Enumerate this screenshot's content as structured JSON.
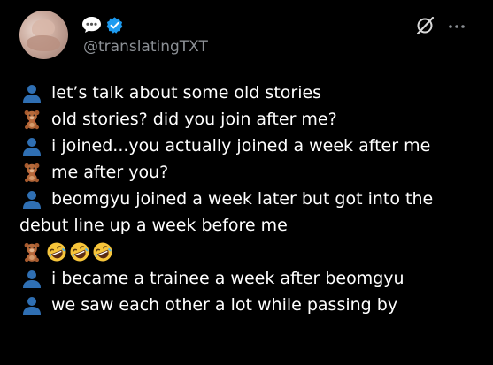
{
  "tweet": {
    "handle": "@translatingTXT",
    "lines": [
      {
        "speaker": "person-icon",
        "text": "let’s talk about some old stories"
      },
      {
        "speaker": "teddy-bear-icon",
        "text": "old stories? did you join after me?"
      },
      {
        "speaker": "person-icon",
        "text": "i joined...you actually joined a week after me"
      },
      {
        "speaker": "teddy-bear-icon",
        "text": "me after you?"
      },
      {
        "speaker": "person-icon",
        "text": "beomgyu joined a week later but got into the"
      },
      {
        "speaker": "",
        "text": "debut line up a week before me"
      },
      {
        "speaker": "teddy-bear-icon",
        "emojis": [
          "laughing-icon",
          "laughing-icon",
          "laughing-icon"
        ]
      },
      {
        "speaker": "person-icon",
        "text": "i became a trainee a week after beomgyu"
      },
      {
        "speaker": "person-icon",
        "text": "we saw each other a lot while passing by"
      }
    ]
  },
  "colors": {
    "background": "#000000",
    "text": "#ffffff",
    "handle": "#8b8f94",
    "verified": "#1d9bf0",
    "person_icon": "#2f6fb3"
  }
}
